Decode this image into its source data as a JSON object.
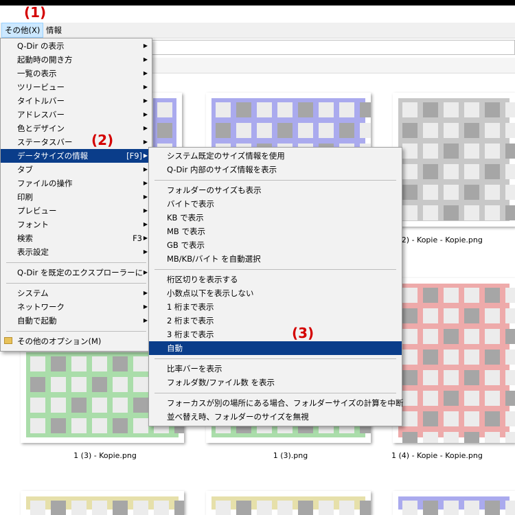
{
  "menubar": {
    "items": [
      "その他(X)",
      "情報"
    ]
  },
  "annotations": [
    "(1)",
    "(2)",
    "(3)"
  ],
  "main_menu": [
    {
      "label": "Q-Dir の表示",
      "sub": true
    },
    {
      "label": "起動時の開き方",
      "sub": true
    },
    {
      "label": "一覧の表示",
      "sub": true
    },
    {
      "label": "ツリービュー",
      "sub": true
    },
    {
      "label": "タイトルバー",
      "sub": true
    },
    {
      "label": "アドレスバー",
      "sub": true
    },
    {
      "label": "色とデザイン",
      "sub": true
    },
    {
      "label": "ステータスバー",
      "sub": true
    },
    {
      "label": "データサイズの情報",
      "shortcut": "[F9]",
      "sub": true,
      "highlighted": true
    },
    {
      "label": "タブ",
      "sub": true
    },
    {
      "label": "ファイルの操作",
      "sub": true
    },
    {
      "label": "印刷",
      "sub": true
    },
    {
      "label": "プレビュー",
      "sub": true
    },
    {
      "label": "フォント",
      "sub": true
    },
    {
      "label": "検索",
      "shortcut": "F3",
      "sub": true
    },
    {
      "label": "表示設定",
      "sub": true
    },
    {
      "separator": true
    },
    {
      "label": "Q-Dir を既定のエクスプローラーに",
      "sub": true
    },
    {
      "separator": true
    },
    {
      "label": "システム",
      "sub": true
    },
    {
      "label": "ネットワーク",
      "sub": true
    },
    {
      "label": "自動で起動",
      "sub": true
    },
    {
      "separator": true
    },
    {
      "label": "その他のオプション(M)",
      "icon": "folder-icon"
    }
  ],
  "sub_menu": [
    {
      "label": "システム既定のサイズ情報を使用"
    },
    {
      "label": "Q-Dir 内部のサイズ情報を表示"
    },
    {
      "separator": true
    },
    {
      "label": "フォルダーのサイズも表示"
    },
    {
      "label": "バイトで表示"
    },
    {
      "label": "KB で表示"
    },
    {
      "label": "MB で表示"
    },
    {
      "label": "GB で表示"
    },
    {
      "label": "MB/KB/バイト を自動選択"
    },
    {
      "separator": true
    },
    {
      "label": "桁区切りを表示する"
    },
    {
      "label": "小数点以下を表示しない"
    },
    {
      "label": "1 桁まで表示"
    },
    {
      "label": "2 桁まで表示"
    },
    {
      "label": "3 桁まで表示"
    },
    {
      "label": "自動",
      "highlighted": true
    },
    {
      "separator": true
    },
    {
      "label": "比率バーを表示"
    },
    {
      "label": "フォルダ数/ファイル数 を表示"
    },
    {
      "separator": true
    },
    {
      "label": "フォーカスが別の場所にある場合、フォルダーサイズの計算を中断"
    },
    {
      "label": "並べ替え時、フォルダーのサイズを無視"
    }
  ],
  "files": [
    {
      "name": "",
      "color": "#aaaaee"
    },
    {
      "name": "",
      "color": "#aaaaee"
    },
    {
      "name": "1 (2) - Kopie - Kopie.png",
      "color": "#c8c8c8"
    },
    {
      "name": "",
      "color": "#aaddaa"
    },
    {
      "name": "",
      "color": "#aaddaa"
    },
    {
      "name": "",
      "color": "#eeaaaa"
    },
    {
      "name": "1 (3) - Kopie.png",
      "color": "#aaddaa"
    },
    {
      "name": "1 (3).png",
      "color": "#aaddaa"
    },
    {
      "name": "1 (4) - Kopie - Kopie.png",
      "color": "#eeaaaa"
    },
    {
      "name": "",
      "color": "#e6e0aa"
    },
    {
      "name": "",
      "color": "#e6e0aa"
    },
    {
      "name": "",
      "color": "#aaaaee"
    }
  ]
}
